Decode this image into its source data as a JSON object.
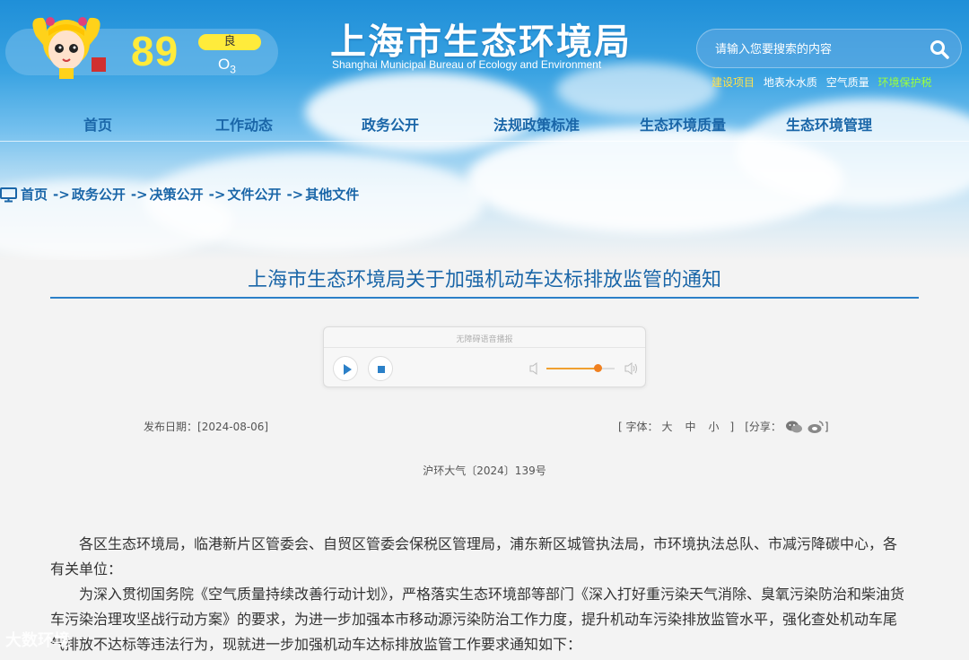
{
  "aqi": {
    "value": "89",
    "level": "良",
    "pollutant": "O",
    "pollutant_sub": "3"
  },
  "logo": {
    "name_cn": "上海市生态环境局",
    "name_en": "Shanghai Municipal Bureau of Ecology and Environment"
  },
  "search": {
    "placeholder": "请输入您要搜索的内容",
    "icon": "search-icon"
  },
  "quick_links": [
    "建设项目",
    "地表水水质",
    "空气质量",
    "环境保护税"
  ],
  "colors": {
    "nav_text": "#1a66a8",
    "aqi_yellow": "#ffeb3b",
    "quick_link_highlight": "#ffe14d",
    "quick_link_green": "#9cff3a",
    "title_rule": "#2b80c8"
  },
  "nav": {
    "items": [
      "首页",
      "工作动态",
      "政务公开",
      "法规政策标准",
      "生态环境质量",
      "生态环境管理"
    ]
  },
  "breadcrumb": {
    "icon": "monitor-icon",
    "items": [
      "首页",
      "政务公开",
      "决策公开",
      "文件公开",
      "其他文件"
    ],
    "separator": "->"
  },
  "article": {
    "title": "上海市生态环境局关于加强机动车达标排放监管的通知",
    "publish_label": "发布日期：",
    "publish_date": "[2024-08-06]",
    "font_label": "[ 字体：",
    "font_large": "大",
    "font_medium": "中",
    "font_small": "小",
    "font_close": "]",
    "share_open": "[分享：",
    "share_close": "]",
    "doc_number": "沪环大气〔2024〕139号",
    "paragraphs": [
      "各区生态环境局，临港新片区管委会、自贸区管委会保税区管理局，浦东新区城管执法局，市环境执法总队、市减污降碳中心，各有关单位：",
      "为深入贯彻国务院《空气质量持续改善行动计划》，严格落实生态环境部等部门《深入打好重污染天气消除、臭氧污染防治和柴油货车污染治理攻坚战行动方案》的要求，为进一步加强本市移动源污染防治工作力度，提升机动车污染排放监管水平，强化查处机动车尾气排放不达标等违法行为，现就进一步加强机动车达标排放监管工作要求通知如下："
    ]
  },
  "player": {
    "label": "无障碍语音播报",
    "volume": 0.75
  },
  "watermark": "大数环境"
}
